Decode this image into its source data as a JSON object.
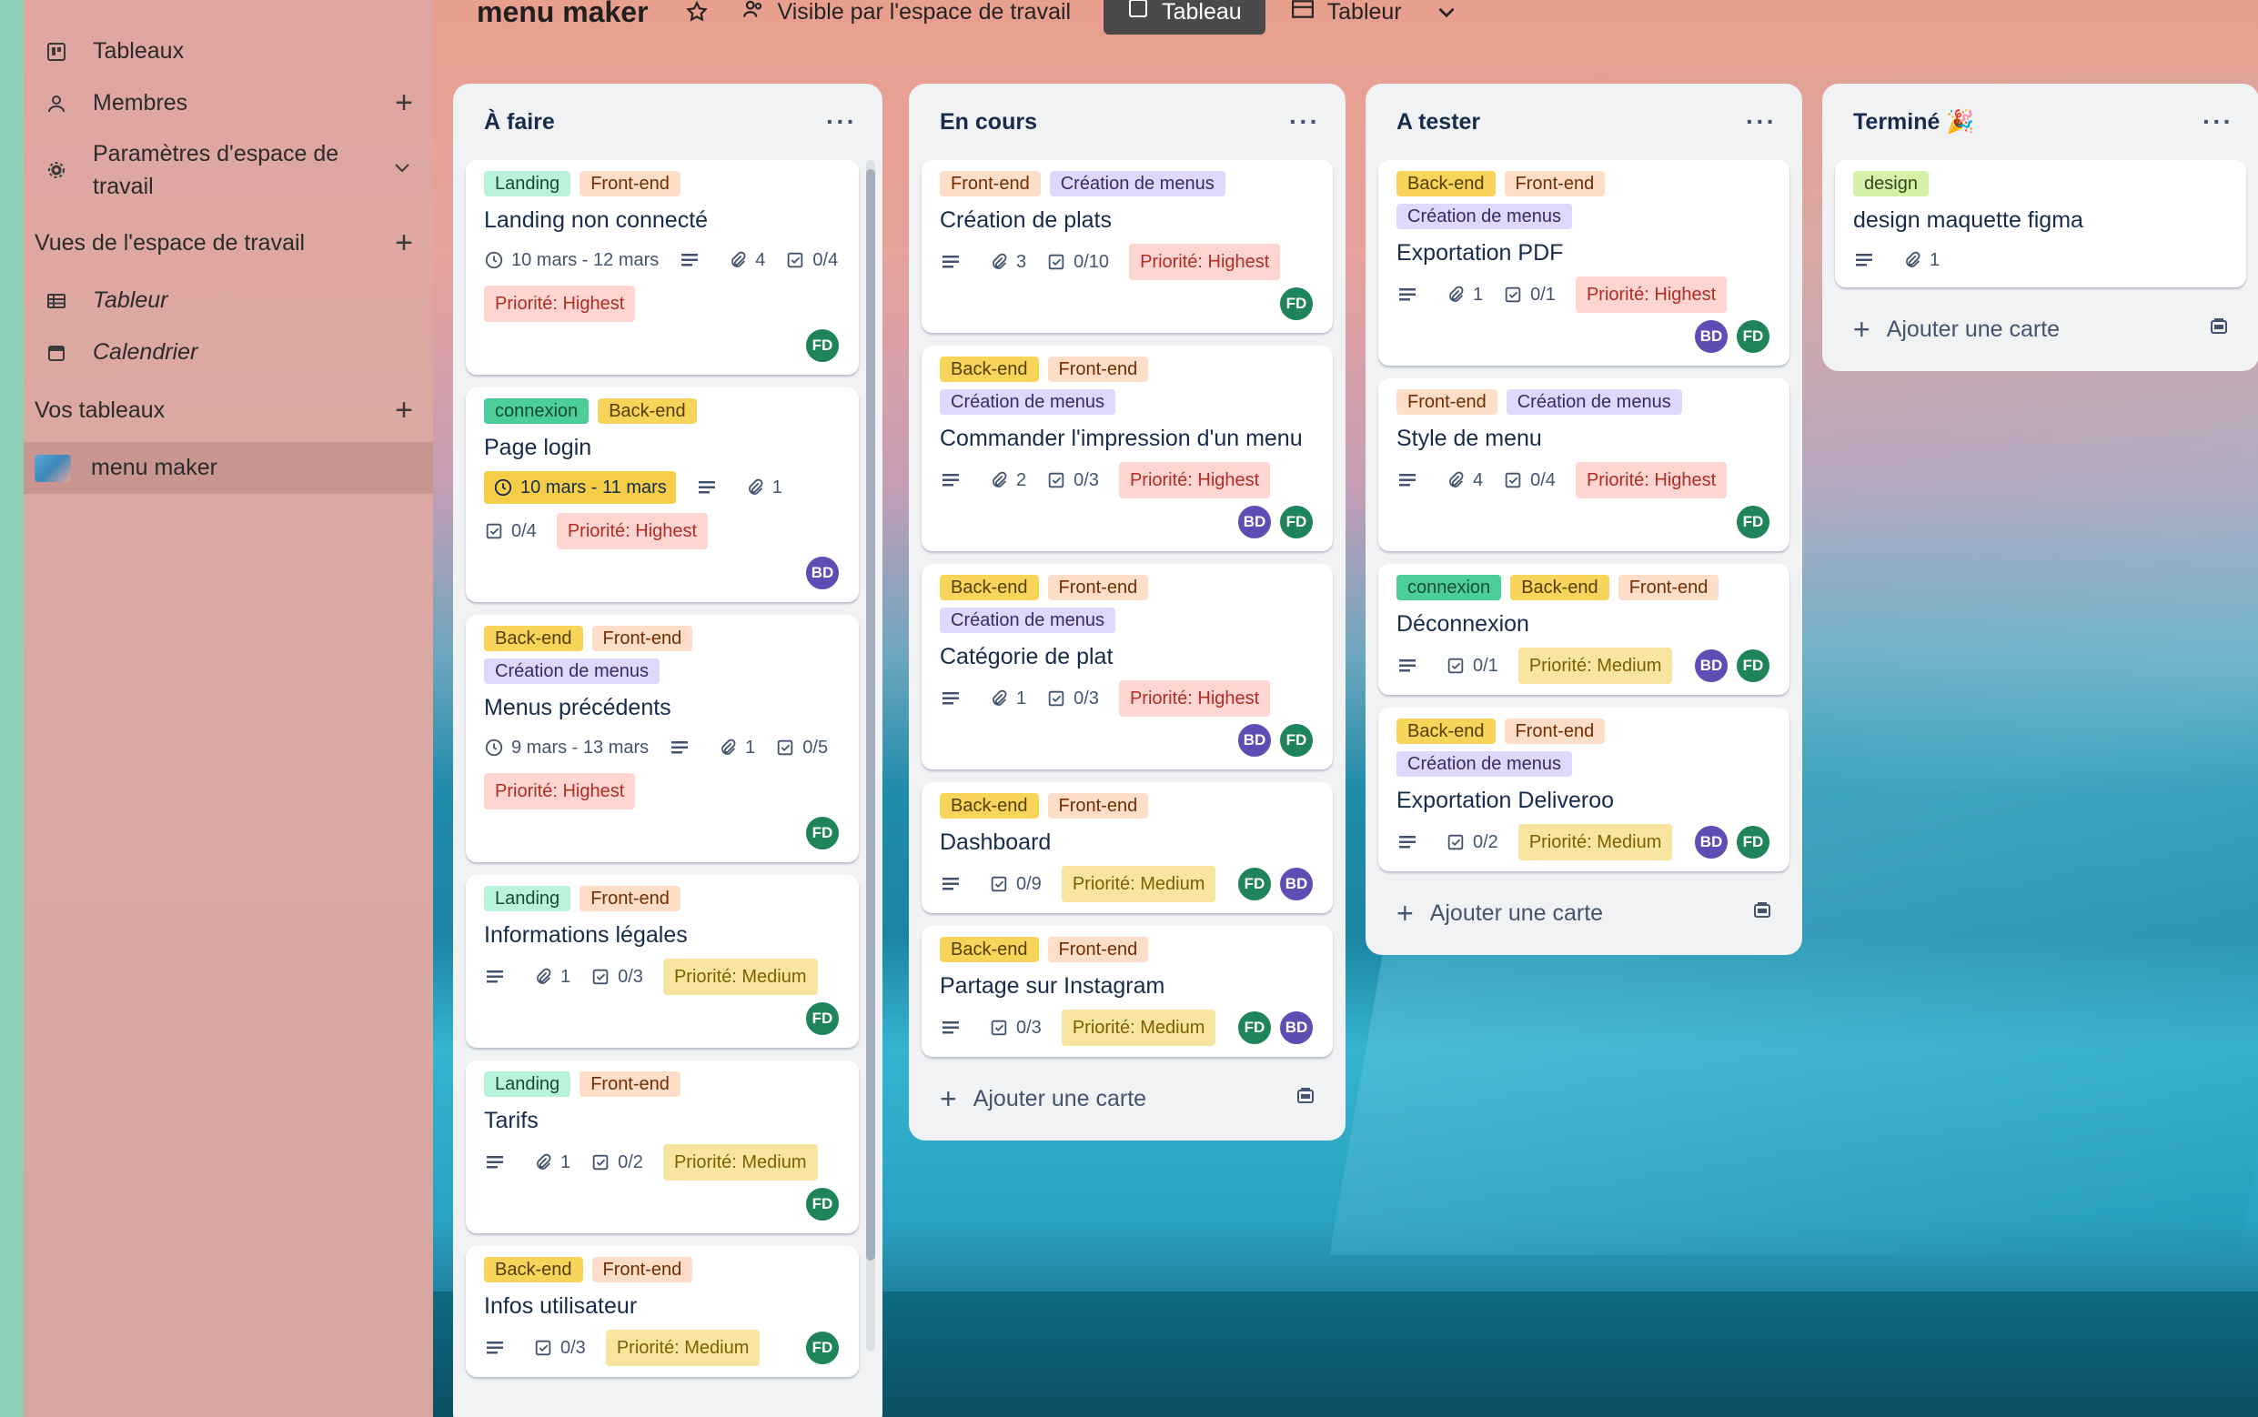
{
  "colors": {
    "sidebar": "#dba8a3",
    "list_bg": "#f1f2f4",
    "accent_fd": "#1f845a",
    "accent_bd": "#5e4db2"
  },
  "sidebar": {
    "items": [
      {
        "label": "Tableaux",
        "icon": "board-icon"
      },
      {
        "label": "Membres",
        "icon": "person-icon"
      },
      {
        "label": "Paramètres d'espace de travail",
        "icon": "gear-icon"
      }
    ],
    "views_title": "Vues de l'espace de travail",
    "views": [
      {
        "label": "Tableur",
        "icon": "table-icon"
      },
      {
        "label": "Calendrier",
        "icon": "calendar-icon"
      }
    ],
    "boards_title": "Vos tableaux",
    "boards": [
      {
        "label": "menu maker"
      }
    ]
  },
  "topbar": {
    "title": "menu maker",
    "visibility": "Visible par l'espace de travail",
    "view_board": "Tableau",
    "view_table": "Tableur"
  },
  "add_card_label": "Ajouter une carte",
  "lists": [
    {
      "title": "À faire",
      "cards": [
        {
          "labels": [
            "Landing",
            "Front-end"
          ],
          "title": "Landing non connecté",
          "dates": "10 mars - 12 mars",
          "attachments": "4",
          "checklist": "0/4",
          "priority": "Priorité: Highest",
          "members": [
            "FD"
          ]
        },
        {
          "labels": [
            "connexion",
            "Back-end"
          ],
          "title": "Page login",
          "dates": "10 mars - 11 mars",
          "attachments": "1",
          "checklist": "0/4",
          "priority": "Priorité: Highest",
          "members": [
            "BD"
          ]
        },
        {
          "labels": [
            "Back-end",
            "Front-end",
            "Création de menus"
          ],
          "title": "Menus précédents",
          "dates": "9 mars - 13 mars",
          "attachments": "1",
          "checklist": "0/5",
          "priority": "Priorité: Highest",
          "members": [
            "FD"
          ]
        },
        {
          "labels": [
            "Landing",
            "Front-end"
          ],
          "title": "Informations légales",
          "attachments": "1",
          "checklist": "0/3",
          "priority": "Priorité: Medium",
          "members": [
            "FD"
          ]
        },
        {
          "labels": [
            "Landing",
            "Front-end"
          ],
          "title": "Tarifs",
          "attachments": "1",
          "checklist": "0/2",
          "priority": "Priorité: Medium",
          "members": [
            "FD"
          ]
        },
        {
          "labels": [
            "Back-end",
            "Front-end"
          ],
          "title": "Infos utilisateur",
          "checklist": "0/3",
          "priority": "Priorité: Medium",
          "members": [
            "FD"
          ]
        }
      ]
    },
    {
      "title": "En cours",
      "cards": [
        {
          "labels": [
            "Front-end",
            "Création de menus"
          ],
          "title": "Création de plats",
          "attachments": "3",
          "checklist": "0/10",
          "priority": "Priorité: Highest",
          "members": [
            "FD"
          ]
        },
        {
          "labels": [
            "Back-end",
            "Front-end",
            "Création de menus"
          ],
          "title": "Commander l'impression d'un menu",
          "attachments": "2",
          "checklist": "0/3",
          "priority": "Priorité: Highest",
          "members": [
            "BD",
            "FD"
          ]
        },
        {
          "labels": [
            "Back-end",
            "Front-end",
            "Création de menus"
          ],
          "title": "Catégorie de plat",
          "attachments": "1",
          "checklist": "0/3",
          "priority": "Priorité: Highest",
          "members": [
            "BD",
            "FD"
          ]
        },
        {
          "labels": [
            "Back-end",
            "Front-end"
          ],
          "title": "Dashboard",
          "checklist": "0/9",
          "priority": "Priorité: Medium",
          "members": [
            "FD",
            "BD"
          ]
        },
        {
          "labels": [
            "Back-end",
            "Front-end"
          ],
          "title": "Partage sur Instagram",
          "checklist": "0/3",
          "priority": "Priorité: Medium",
          "members": [
            "FD",
            "BD"
          ]
        }
      ]
    },
    {
      "title": "A tester",
      "cards": [
        {
          "labels": [
            "Back-end",
            "Front-end",
            "Création de menus"
          ],
          "title": "Exportation PDF",
          "attachments": "1",
          "checklist": "0/1",
          "priority": "Priorité: Highest",
          "members": [
            "BD",
            "FD"
          ]
        },
        {
          "labels": [
            "Front-end",
            "Création de menus"
          ],
          "title": "Style de menu",
          "attachments": "4",
          "checklist": "0/4",
          "priority": "Priorité: Highest",
          "members": [
            "FD"
          ]
        },
        {
          "labels": [
            "connexion",
            "Back-end",
            "Front-end"
          ],
          "title": "Déconnexion",
          "checklist": "0/1",
          "priority": "Priorité: Medium",
          "members": [
            "BD",
            "FD"
          ]
        },
        {
          "labels": [
            "Back-end",
            "Front-end",
            "Création de menus"
          ],
          "title": "Exportation Deliveroo",
          "checklist": "0/2",
          "priority": "Priorité: Medium",
          "members": [
            "BD",
            "FD"
          ]
        }
      ]
    },
    {
      "title": "Terminé 🎉",
      "cards": [
        {
          "labels": [
            "design"
          ],
          "title": "design maquette figma",
          "attachments": "1"
        }
      ]
    }
  ]
}
